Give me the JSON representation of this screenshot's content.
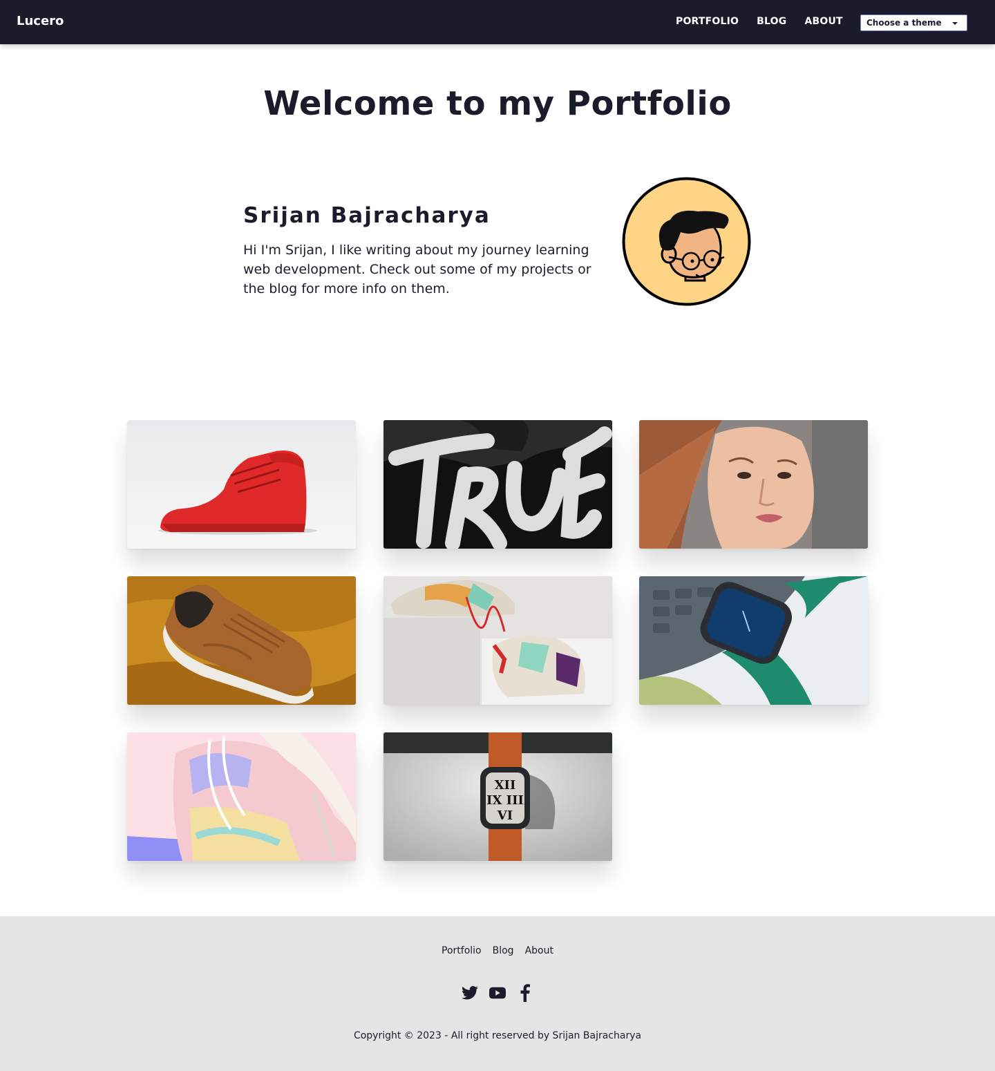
{
  "header": {
    "brand": "Lucero",
    "nav": [
      "PORTFOLIO",
      "BLOG",
      "ABOUT"
    ],
    "theme_select": {
      "selected": "Choose a theme"
    }
  },
  "hero": {
    "title": "Welcome to my Portfolio",
    "name": "Srijan Bajracharya",
    "bio": "Hi I'm Srijan, I like writing about my journey learning web development. Check out some of my projects or the blog for more info on them."
  },
  "gallery": {
    "items": [
      {
        "subject": "red high-top sneaker"
      },
      {
        "subject": "TRUE brush lettering"
      },
      {
        "subject": "freckled face portrait"
      },
      {
        "subject": "brown sneaker on mustard cloth"
      },
      {
        "subject": "colorful sneakers on white blocks"
      },
      {
        "subject": "smartwatch with green strap"
      },
      {
        "subject": "pastel sneaker"
      },
      {
        "subject": "smartwatch with orange strap"
      }
    ]
  },
  "footer": {
    "links": [
      "Portfolio",
      "Blog",
      "About"
    ],
    "socials": [
      "twitter-icon",
      "youtube-icon",
      "facebook-icon"
    ],
    "copyright": "Copyright © 2023 - All right reserved by Srijan Bajracharya"
  },
  "colors": {
    "navbar": "#1a1b2b",
    "text": "#1a1b2b",
    "footer_bg": "#e5e5e5",
    "avatar_bg": "#ffd484"
  }
}
